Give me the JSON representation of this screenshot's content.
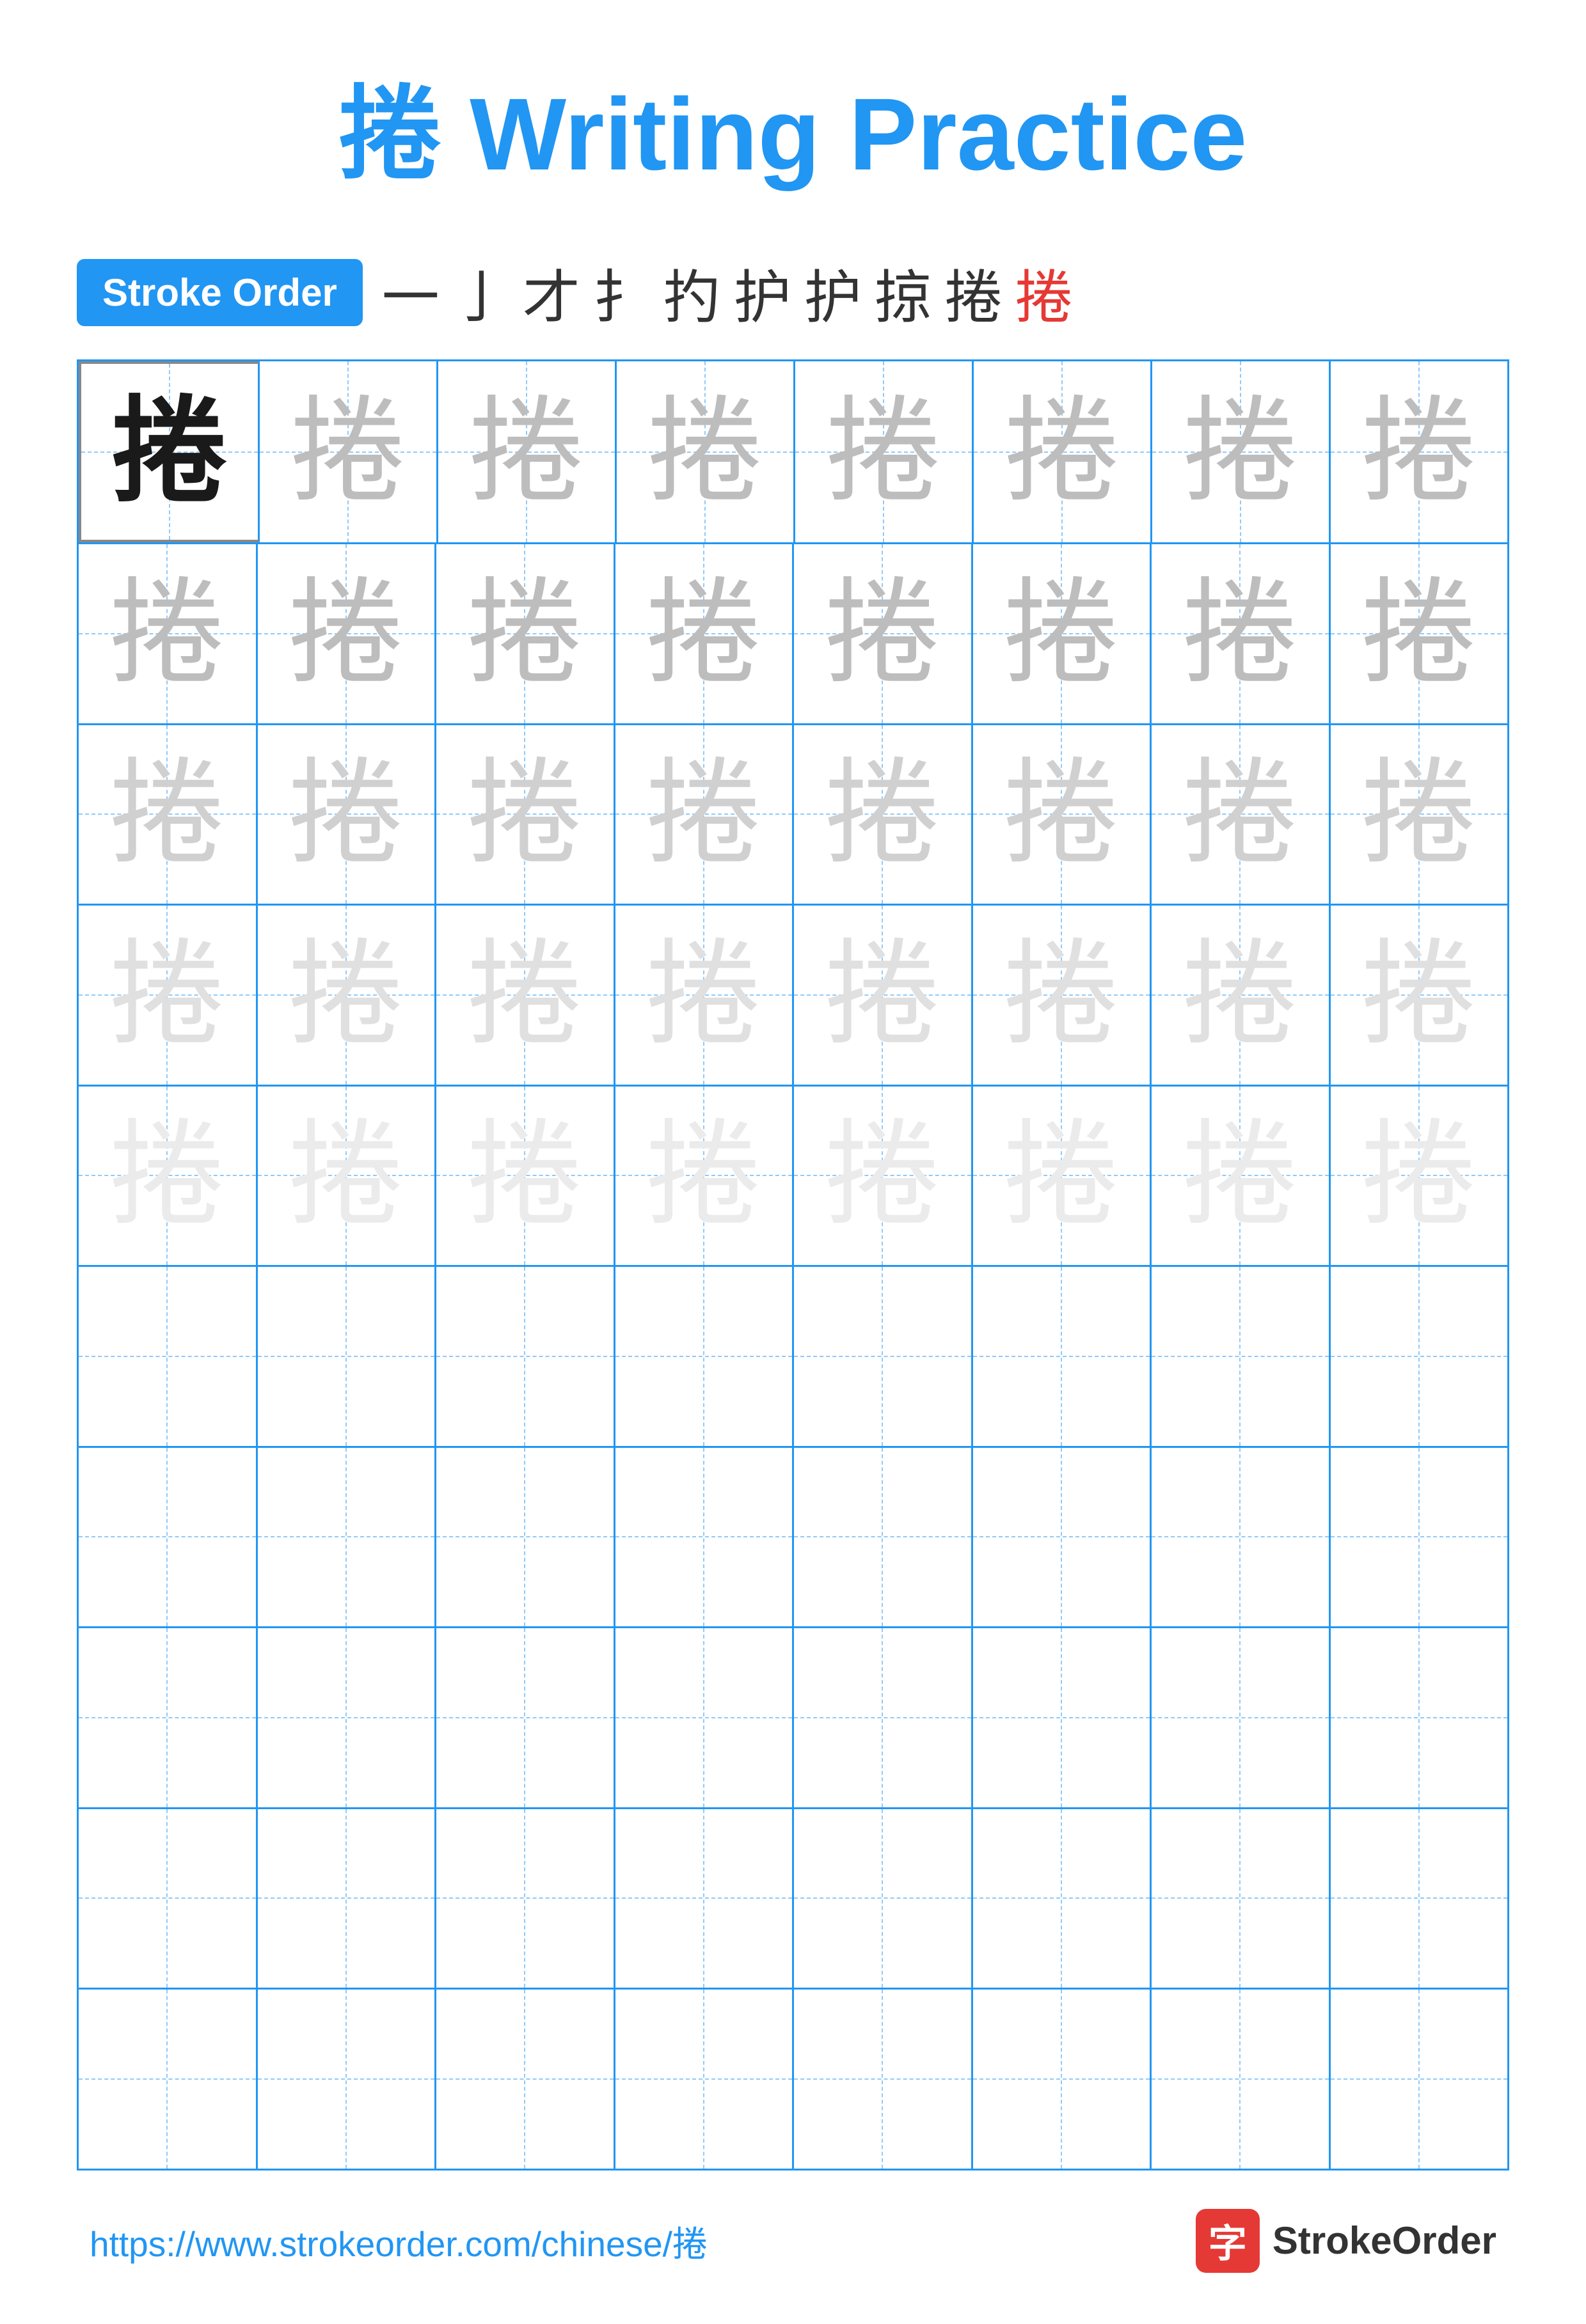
{
  "title": "捲 Writing Practice",
  "strokeOrder": {
    "badge": "Stroke Order",
    "chars": [
      "一",
      "亅",
      "才",
      "扌",
      "扚",
      "护",
      "护",
      "掠",
      "捲",
      "捲"
    ]
  },
  "character": "捲",
  "rows": [
    {
      "cells": [
        "dark",
        "light1",
        "light1",
        "light1",
        "light1",
        "light1",
        "light1",
        "light1"
      ]
    },
    {
      "cells": [
        "light1",
        "light1",
        "light1",
        "light1",
        "light1",
        "light1",
        "light1",
        "light1"
      ]
    },
    {
      "cells": [
        "light2",
        "light2",
        "light2",
        "light2",
        "light2",
        "light2",
        "light2",
        "light2"
      ]
    },
    {
      "cells": [
        "light3",
        "light3",
        "light3",
        "light3",
        "light3",
        "light3",
        "light3",
        "light3"
      ]
    },
    {
      "cells": [
        "light4",
        "light4",
        "light4",
        "light4",
        "light4",
        "light4",
        "light4",
        "light4"
      ]
    },
    {
      "cells": [
        "empty",
        "empty",
        "empty",
        "empty",
        "empty",
        "empty",
        "empty",
        "empty"
      ]
    },
    {
      "cells": [
        "empty",
        "empty",
        "empty",
        "empty",
        "empty",
        "empty",
        "empty",
        "empty"
      ]
    },
    {
      "cells": [
        "empty",
        "empty",
        "empty",
        "empty",
        "empty",
        "empty",
        "empty",
        "empty"
      ]
    },
    {
      "cells": [
        "empty",
        "empty",
        "empty",
        "empty",
        "empty",
        "empty",
        "empty",
        "empty"
      ]
    },
    {
      "cells": [
        "empty",
        "empty",
        "empty",
        "empty",
        "empty",
        "empty",
        "empty",
        "empty"
      ]
    }
  ],
  "footer": {
    "url": "https://www.strokeorder.com/chinese/捲",
    "logoText": "StrokeOrder",
    "logoChar": "字"
  }
}
